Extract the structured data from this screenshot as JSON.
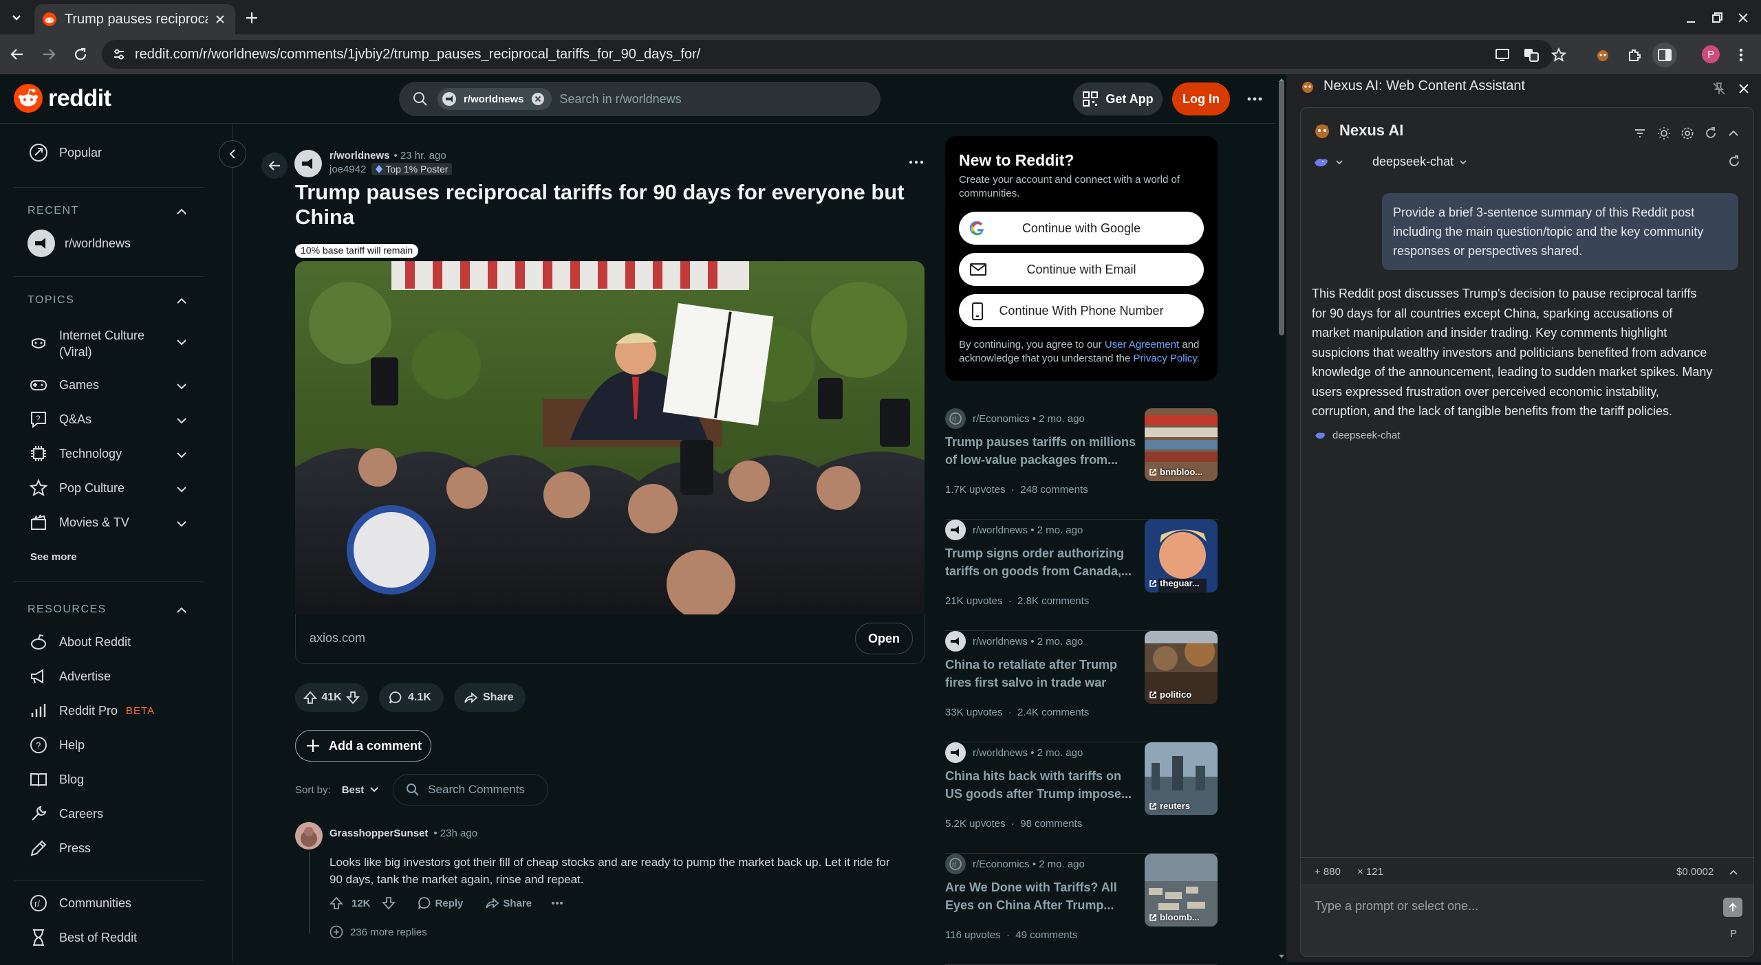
{
  "browser": {
    "tab_title": "Trump pauses reciprocal",
    "url": "reddit.com/r/worldnews/comments/1jvbiy2/trump_pauses_reciprocal_tariffs_for_90_days_for/",
    "profile_initial": "P"
  },
  "reddit_header": {
    "logo_text": "reddit",
    "search_chip": "r/worldnews",
    "search_placeholder": "Search in r/worldnews",
    "get_app": "Get App",
    "log_in": "Log In"
  },
  "sidebar": {
    "popular": "Popular",
    "recent_heading": "RECENT",
    "recent_item": "r/worldnews",
    "topics_heading": "TOPICS",
    "topics": [
      "Internet Culture",
      "(Viral)",
      "Games",
      "Q&As",
      "Technology",
      "Pop Culture",
      "Movies & TV"
    ],
    "see_more": "See more",
    "resources_heading": "RESOURCES",
    "resources": [
      "About Reddit",
      "Advertise",
      "Reddit Pro",
      "Help",
      "Blog",
      "Careers",
      "Press"
    ],
    "beta": "BETA",
    "communities": "Communities",
    "best_of": "Best of Reddit"
  },
  "post": {
    "subreddit": "r/worldnews",
    "time": "• 23 hr. ago",
    "author": "joe4942",
    "flair": "Top 1% Poster",
    "title_line1": "Trump pauses reciprocal tariffs for 90 days for everyone but",
    "title_line2": "China",
    "tag": "10% base tariff will remain",
    "domain": "axios.com",
    "open": "Open",
    "votes": "41K",
    "comments": "4.1K",
    "share": "Share",
    "add_comment": "Add a comment",
    "sort_label": "Sort by:",
    "sort_value": "Best",
    "search_comments": "Search Comments"
  },
  "comment": {
    "author": "GrasshopperSunset",
    "time": "• 23h ago",
    "line1": "Looks like big investors got their fill of cheap stocks and are ready to pump the market back up. Let it ride for",
    "line2": "90 days, tank the market again, rinse and repeat.",
    "votes": "12K",
    "reply": "Reply",
    "share": "Share",
    "more_replies": "236 more replies"
  },
  "signup": {
    "title": "New to Reddit?",
    "sub1": "Create your account and connect with a world of",
    "sub2": "communities.",
    "google": "Continue with Google",
    "email": "Continue with Email",
    "phone": "Continue With Phone Number",
    "legal1": "By continuing, you agree to our",
    "user_agreement": "User Agreement",
    "legal_and": "and",
    "legal2": "acknowledge that you understand the",
    "privacy": "Privacy Policy."
  },
  "related": [
    {
      "sub": "r/Economics",
      "time": "• 2 mo. ago",
      "t1": "Trump pauses tariffs on millions",
      "t2": "of low-value packages from...",
      "stats": "1.7K upvotes  ·  248 comments",
      "src": "bnnbloo..."
    },
    {
      "sub": "r/worldnews",
      "time": "• 2 mo. ago",
      "t1": "Trump signs order authorizing",
      "t2": "tariffs on goods from Canada,...",
      "stats": "21K upvotes  ·  2.8K comments",
      "src": "theguar..."
    },
    {
      "sub": "r/worldnews",
      "time": "• 2 mo. ago",
      "t1": "China to retaliate after Trump",
      "t2": "fires first salvo in trade war",
      "stats": "33K upvotes  ·  2.4K comments",
      "src": "politico"
    },
    {
      "sub": "r/worldnews",
      "time": "• 2 mo. ago",
      "t1": "China hits back with tariffs on",
      "t2": "US goods after Trump impose...",
      "stats": "5.2K upvotes  ·  98 comments",
      "src": "reuters"
    },
    {
      "sub": "r/Economics",
      "time": "• 2 mo. ago",
      "t1": "Are We Done with Tariffs? All",
      "t2": "Eyes on China After Trump...",
      "stats": "116 upvotes  ·  49 comments",
      "src": "bloomb..."
    }
  ],
  "nexus": {
    "panel_title": "Nexus AI: Web Content Assistant",
    "brand": "Nexus AI",
    "model": "deepseek-chat",
    "user_msg1": "Provide a brief 3-sentence summary of this Reddit post",
    "user_msg2": "including the main question/topic and the key community",
    "user_msg3": "responses or perspectives shared.",
    "ai_lines": [
      "This Reddit post discusses Trump's decision to pause reciprocal tariffs",
      "for 90 days for all countries except China, sparking accusations of",
      "market manipulation and insider trading. Key comments highlight",
      "suspicions that wealthy investors and politicians benefited from advance",
      "knowledge of the announcement, leading to sudden market spikes. Many",
      "users expressed frustration over perceived economic instability,",
      "corruption, and the lack of tangible benefits from the tariff policies."
    ],
    "model_tag": "deepseek-chat",
    "tokens_in": "+ 880",
    "tokens_out": "× 121",
    "cost": "$0.0002",
    "input_placeholder": "Type a prompt or select one...",
    "p_label": "P"
  }
}
